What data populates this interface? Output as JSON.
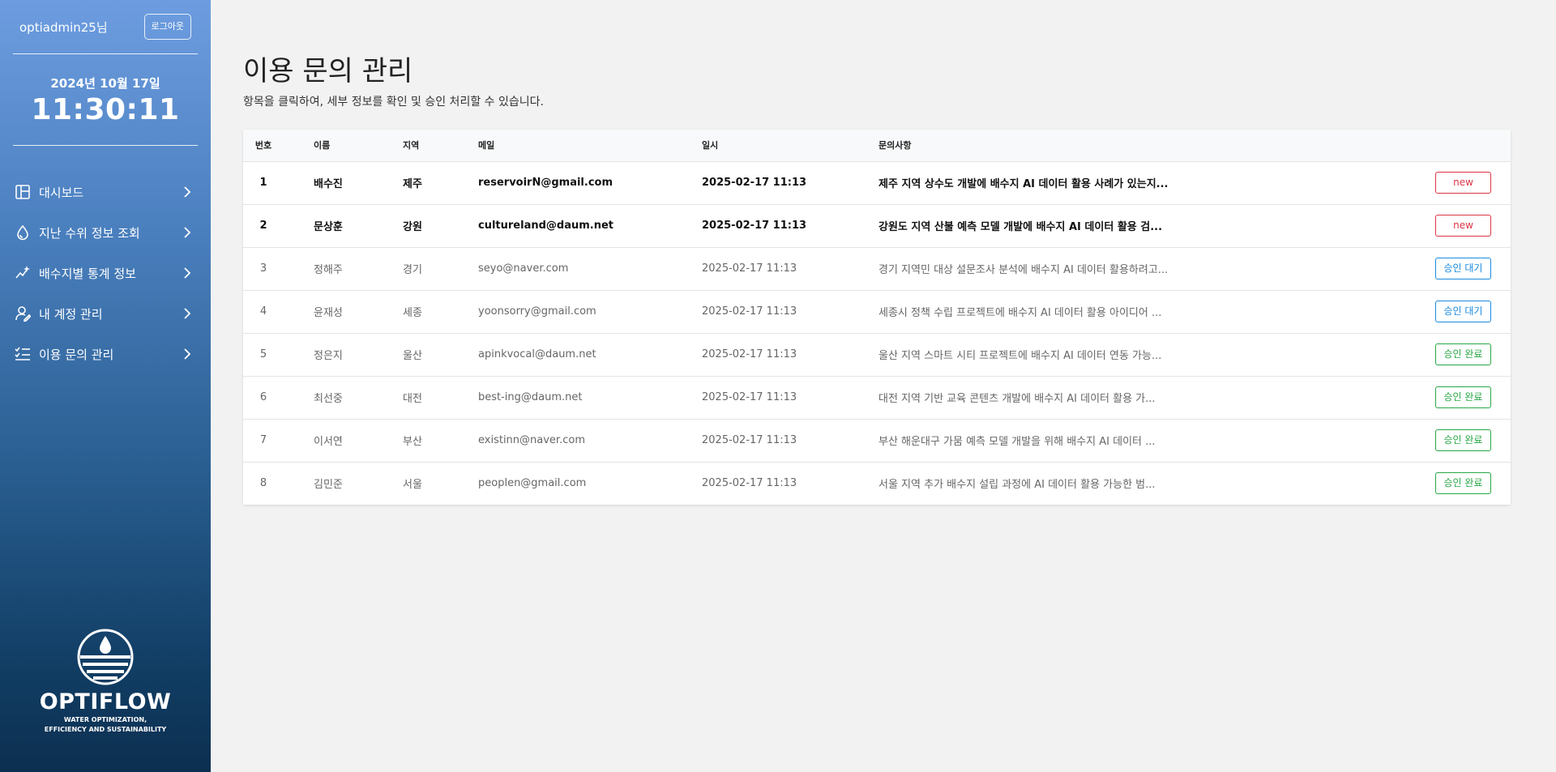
{
  "sidebar": {
    "user_name": "optiadmin25님",
    "logout_label": "로그아웃",
    "date": "2024년 10월 17일",
    "time": "11:30:11",
    "nav_items": [
      {
        "label": "대시보드",
        "icon": "dashboard-icon"
      },
      {
        "label": "지난 수위 정보 조회",
        "icon": "water-drop-icon"
      },
      {
        "label": "배수지별 통계 정보",
        "icon": "stats-sparkle-icon"
      },
      {
        "label": "내 계정 관리",
        "icon": "user-settings-icon"
      },
      {
        "label": "이용 문의 관리",
        "icon": "checklist-icon"
      }
    ],
    "brand_name": "OPTIFLOW",
    "brand_sub_line1": "WATER OPTIMIZATION,",
    "brand_sub_line2": "EFFICIENCY AND SUSTAINABILITY"
  },
  "main": {
    "title": "이용 문의 관리",
    "subtitle": "항목을 클릭하여, 세부 정보를 확인 및 승인 처리할 수 있습니다.",
    "columns": [
      "번호",
      "이름",
      "지역",
      "메일",
      "일시",
      "문의사항",
      ""
    ],
    "rows": [
      {
        "no": "1",
        "name": "배수진",
        "region": "제주",
        "email": "reservoirN@gmail.com",
        "date": "2025-02-17 11:13",
        "query": "제주 지역 상수도 개발에 배수지 AI 데이터 활용 사례가 있는지...",
        "status": "new",
        "status_type": "new"
      },
      {
        "no": "2",
        "name": "문상훈",
        "region": "강원",
        "email": "cultureland@daum.net",
        "date": "2025-02-17 11:13",
        "query": "강원도 지역 산불 예측 모델 개발에 배수지 AI 데이터 활용 검...",
        "status": "new",
        "status_type": "new"
      },
      {
        "no": "3",
        "name": "정해주",
        "region": "경기",
        "email": "seyo@naver.com",
        "date": "2025-02-17 11:13",
        "query": "경기 지역민 대상 설문조사 분석에 배수지 AI 데이터 활용하려고...",
        "status": "승인 대기",
        "status_type": "wait"
      },
      {
        "no": "4",
        "name": "윤재성",
        "region": "세종",
        "email": "yoonsorry@gmail.com",
        "date": "2025-02-17 11:13",
        "query": "세종시 정책 수립 프로젝트에 배수지 AI 데이터 활용 아이디어 ...",
        "status": "승인 대기",
        "status_type": "wait"
      },
      {
        "no": "5",
        "name": "정은지",
        "region": "울산",
        "email": "apinkvocal@daum.net",
        "date": "2025-02-17 11:13",
        "query": "울산 지역 스마트 시티 프로젝트에 배수지 AI 데이터 연동 가능...",
        "status": "승인 완료",
        "status_type": "done"
      },
      {
        "no": "6",
        "name": "최선중",
        "region": "대전",
        "email": "best-ing@daum.net",
        "date": "2025-02-17 11:13",
        "query": "대전 지역 기반 교육 콘텐츠 개발에 배수지 AI 데이터 활용 가...",
        "status": "승인 완료",
        "status_type": "done"
      },
      {
        "no": "7",
        "name": "이서연",
        "region": "부산",
        "email": "existinn@naver.com",
        "date": "2025-02-17 11:13",
        "query": "부산 해운대구 가뭄 예측 모델 개발을 위해 배수지 AI 데이터 ...",
        "status": "승인 완료",
        "status_type": "done"
      },
      {
        "no": "8",
        "name": "김민준",
        "region": "서울",
        "email": "peoplen@gmail.com",
        "date": "2025-02-17 11:13",
        "query": "서울 지역 추가 배수지 설립 과정에 AI 데이터 활용 가능한 범...",
        "status": "승인 완료",
        "status_type": "done"
      }
    ]
  }
}
